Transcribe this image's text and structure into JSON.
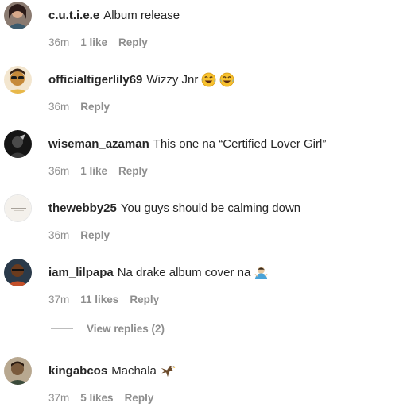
{
  "comments": [
    {
      "username": "c.u.t.i.e.e",
      "text": "Album release",
      "time": "36m",
      "likes": "1 like",
      "reply": "Reply",
      "avatar_color": "#3a2a2a"
    },
    {
      "username": "officialtigerlily69",
      "text": "Wizzy Jnr",
      "time": "36m",
      "likes": "",
      "reply": "Reply",
      "emoji": [
        "laughing-tears-emoji",
        "laughing-tears-emoji"
      ],
      "avatar_color": "#c68a3a"
    },
    {
      "username": "wiseman_azaman",
      "text": "This one na “Certified Lover Girl”",
      "time": "36m",
      "likes": "1 like",
      "reply": "Reply",
      "avatar_color": "#1a1a1a"
    },
    {
      "username": "thewebby25",
      "text": "You guys should be calming down",
      "time": "36m",
      "likes": "",
      "reply": "Reply",
      "avatar_color": "#f4f1ec"
    },
    {
      "username": "iam_lilpapa",
      "text": "Na drake album cover na",
      "time": "37m",
      "likes": "11 likes",
      "reply": "Reply",
      "emoji": [
        "person-shrugging-emoji"
      ],
      "avatar_color": "#6a3b1e"
    },
    {
      "username": "kingabcos",
      "text": "Machala",
      "time": "37m",
      "likes": "5 likes",
      "reply": "Reply",
      "emoji": [
        "eagle-emoji"
      ],
      "avatar_color": "#7a5a3c"
    }
  ],
  "view_replies": "View replies (2)",
  "colors": {
    "text": "#262626",
    "meta": "#8e8e8e",
    "background": "#ffffff"
  }
}
